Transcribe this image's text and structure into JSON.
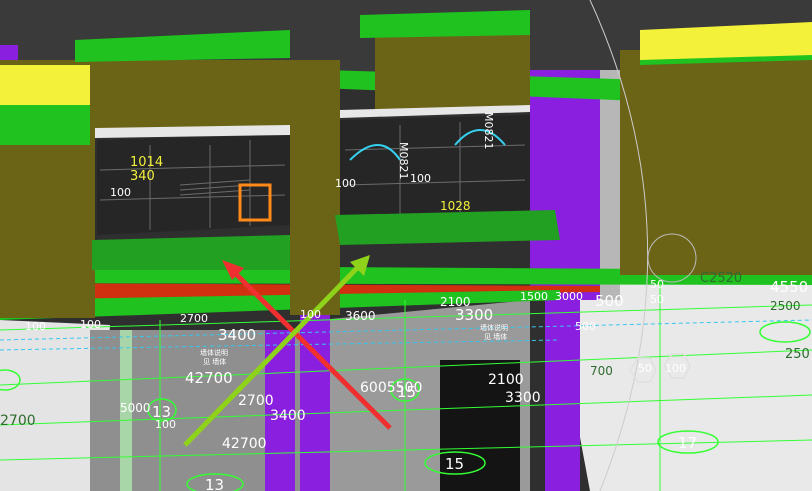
{
  "colors": {
    "wall_green": "#1fc21f",
    "wall_olive": "#6b6416",
    "column_purple": "#8a1fe0",
    "beam_yellow": "#f4f13a",
    "floor_grey": "#8c8c8c",
    "grid_green": "#33ff33",
    "arrow_red": "#f03030",
    "arrow_green": "#8fd21a"
  },
  "labels": {
    "d3400_top": "3400",
    "d42700_mid": "42700",
    "d3300_mid": "3300",
    "d500_right": "500",
    "d4550_right": "4550",
    "d2700_left": "2700",
    "d2700_low": "2700",
    "d3400_low": "3400",
    "d42700_low": "42700",
    "d6005500": "6005500",
    "d2100_low": "2100",
    "d3300_low": "3300",
    "d2100_mid": "2100",
    "d3600": "3600",
    "d100_a": "100",
    "d100_b": "100",
    "d100_c": "100",
    "d100_d": "100",
    "d100_e": "100",
    "d100_f": "100",
    "d100_g": "100",
    "d2700_top": "2700",
    "d50_a": "50",
    "d50_b": "50",
    "d1500": "1500",
    "d3000": "3000",
    "d5000": "5000",
    "d500_r": "500",
    "d250": "250",
    "d2500": "2500",
    "d700": "700",
    "d1014": "1014",
    "d340": "340",
    "d1028": "1028",
    "m0821": "M0821",
    "m0821b": "M0821",
    "c2520": "C2520",
    "axis_13a": "13",
    "axis_13b": "13",
    "axis_15a": "15",
    "axis_15b": "15",
    "axis_17": "17",
    "axis_5": "50",
    "axis_100": "100",
    "small_a": "墙体说明",
    "small_b": "见 墙体",
    "small_c": "墙体说明",
    "small_d": "见 墙体"
  }
}
